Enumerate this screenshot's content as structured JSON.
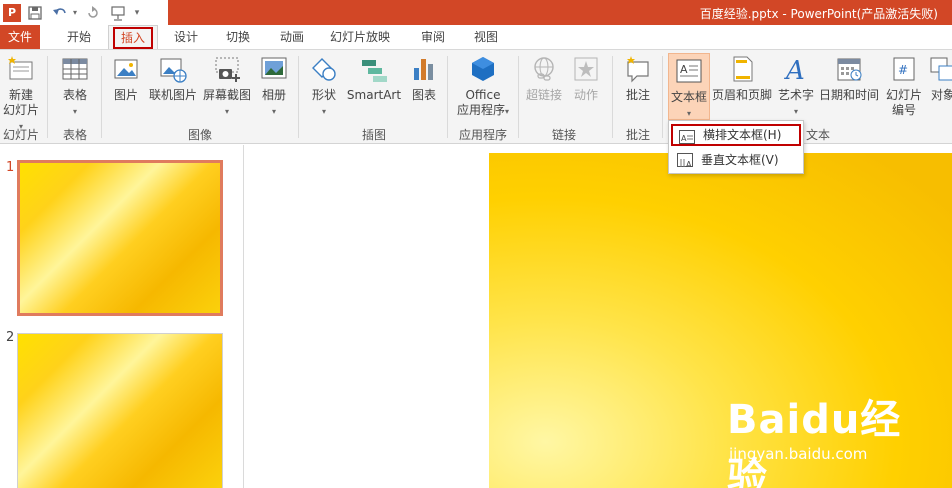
{
  "titlebar": {
    "app_icon_letter": "P",
    "title": "百度经验.pptx - PowerPoint(产品激活失败)"
  },
  "tabs": [
    "文件",
    "开始",
    "插入",
    "设计",
    "切换",
    "动画",
    "幻灯片放映",
    "审阅",
    "视图"
  ],
  "ribbon": {
    "buttons": {
      "new_slide": "新建\n幻灯片",
      "table": "表格",
      "picture": "图片",
      "online_picture": "联机图片",
      "screenshot": "屏幕截图",
      "album": "相册",
      "shapes": "形状",
      "smartart": "SmartArt",
      "chart": "图表",
      "office_apps": "Office\n应用程序",
      "hyperlink": "超链接",
      "action": "动作",
      "comment": "批注",
      "textbox": "文本框",
      "header_footer": "页眉和页脚",
      "wordart": "艺术字",
      "datetime": "日期和时间",
      "slide_number": "幻灯片\n编号",
      "object": "对象"
    },
    "groups": {
      "slides": "幻灯片",
      "tables": "表格",
      "images": "图像",
      "illustrations": "插图",
      "apps": "应用程序",
      "links": "链接",
      "comments": "批注",
      "text": "文本"
    }
  },
  "dropdown": {
    "items": [
      "横排文本框(H)",
      "垂直文本框(V)"
    ]
  },
  "thumbnails": {
    "numbers": [
      "1",
      "2"
    ]
  },
  "watermark": {
    "logo": "Baidu经验",
    "url": "jingyan.baidu.com"
  },
  "colors": {
    "accent": "#d24726",
    "highlight": "#c00000",
    "slide_gold": "#ffd000"
  }
}
